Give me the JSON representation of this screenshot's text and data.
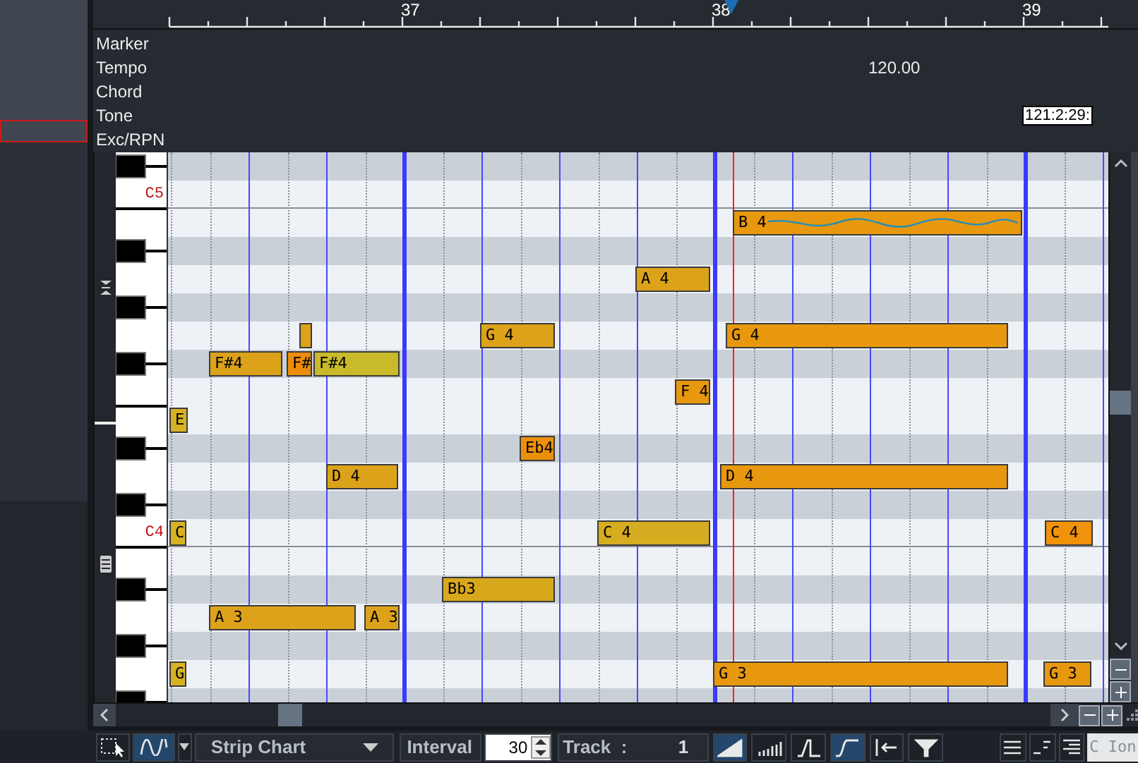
{
  "ruler": {
    "labels": [
      "37",
      "38",
      "39"
    ]
  },
  "event_lanes": [
    {
      "label": "Marker"
    },
    {
      "label": "Tempo",
      "value": "120.00",
      "kind": "plain"
    },
    {
      "label": "Chord"
    },
    {
      "label": "Tone",
      "value": "121:2:29:",
      "kind": "boxed"
    },
    {
      "label": "Exc/RPN"
    }
  ],
  "keyboard": {
    "labels": [
      "C5",
      "C4"
    ]
  },
  "notes": [
    {
      "label": "B 4",
      "color": "#e8980e",
      "bend": true
    },
    {
      "label": "A 4",
      "color": "#dca21a",
      "bend": false
    },
    {
      "color": "#dca21a",
      "bend": false
    },
    {
      "label": "G 4",
      "color": "#dca21a",
      "bend": false
    },
    {
      "label": "G 4",
      "color": "#e8980e",
      "bend": false
    },
    {
      "label": "F#4",
      "color": "#dca21a",
      "bend": false
    },
    {
      "label": "F#",
      "color": "#ec8c0a",
      "bend": false
    },
    {
      "label": "F#4",
      "color": "#c8ba2a",
      "bend": false
    },
    {
      "label": "F 4",
      "color": "#e8980e",
      "bend": false
    },
    {
      "label": "E",
      "color": "#d6b224",
      "bend": false
    },
    {
      "label": "Eb4",
      "color": "#ec900c",
      "bend": false
    },
    {
      "label": "D 4",
      "color": "#dca21a",
      "bend": false
    },
    {
      "label": "D 4",
      "color": "#e8980e",
      "bend": false
    },
    {
      "label": "C",
      "color": "#d6b224",
      "bend": false
    },
    {
      "label": "C 4",
      "color": "#d6ac20",
      "bend": false
    },
    {
      "label": "C 4",
      "color": "#f0920a",
      "bend": false
    },
    {
      "label": "Bb3",
      "color": "#d8a81c",
      "bend": false
    },
    {
      "label": "A 3",
      "color": "#dca21a",
      "bend": false
    },
    {
      "label": "A 3",
      "color": "#dca21a",
      "bend": false
    },
    {
      "label": "G",
      "color": "#d6b224",
      "bend": false
    },
    {
      "label": "G 3",
      "color": "#e8980e",
      "bend": false
    },
    {
      "label": "G 3",
      "color": "#e8980e",
      "bend": false
    }
  ],
  "toolbar": {
    "tool_buttons": [
      {
        "selected": false
      },
      {
        "selected": true
      }
    ],
    "chart_type": "Strip Chart",
    "interval_label": "Interval",
    "interval": "30",
    "track_label": "Track  :",
    "track": "1",
    "shape_buttons": [
      {
        "selected": true
      },
      {
        "selected": false
      },
      {
        "selected": false
      },
      {
        "selected": true
      },
      {
        "selected": false
      },
      {
        "selected": false
      }
    ],
    "key": "C Ion"
  }
}
